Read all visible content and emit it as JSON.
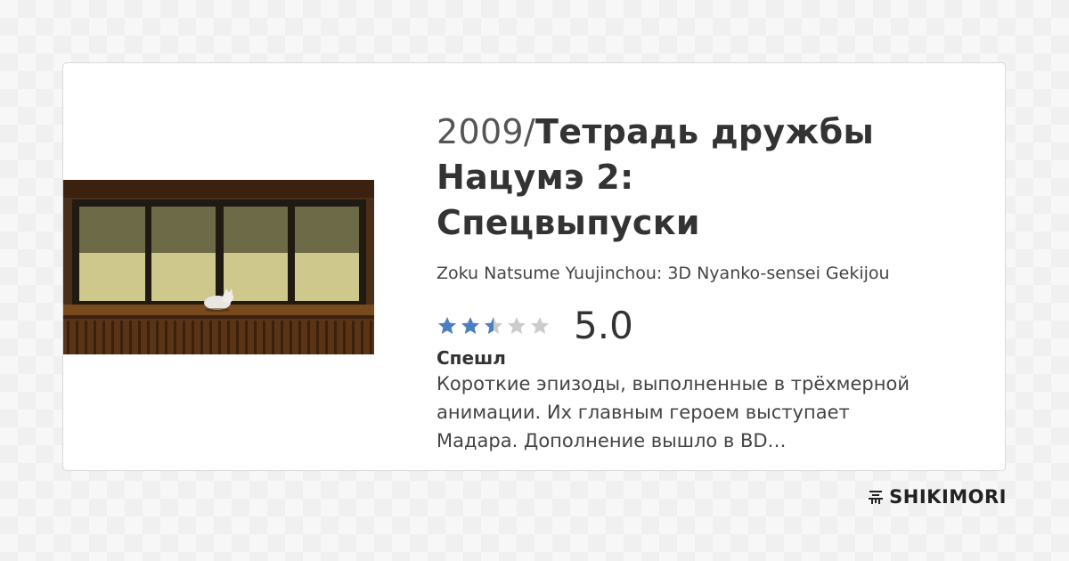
{
  "card": {
    "year": "2009",
    "separator": "/",
    "title_line1": "Тетрадь дружбы",
    "title_line2": "Нацумэ 2:",
    "title_line3": "Спецвыпуски",
    "alt_name": "Zoku Natsume Yuujinchou: 3D Nyanko-sensei Gekijou",
    "rating": {
      "stars_total": 5,
      "stars_value": 2.5,
      "score": "5.0",
      "filled_color": "#4a7fc1",
      "empty_color": "#cccccc"
    },
    "kind": "Спешл",
    "description": "Короткие эпизоды, выполненные в трёхмерной анимации. Их главным героем выступает Мадара. Дополнение вышло в BD…"
  },
  "brand": {
    "icon": "shikimori-logo-icon",
    "name": "SHIKIMORI"
  }
}
